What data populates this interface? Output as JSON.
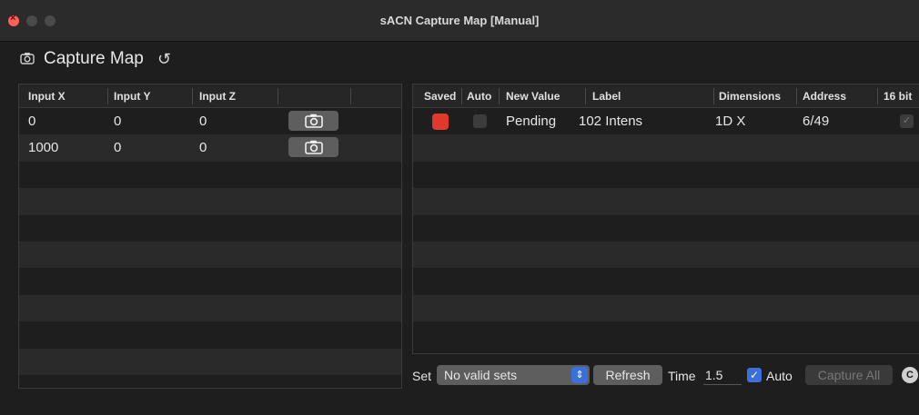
{
  "window": {
    "title": "sACN Capture Map [Manual]"
  },
  "toolbar": {
    "title": "Capture Map",
    "camera_icon": "camera-icon",
    "reset_icon": "reset-icon"
  },
  "inputs_table": {
    "columns": [
      "Input X",
      "Input Y",
      "Input Z"
    ],
    "rows": [
      {
        "x": "0",
        "y": "0",
        "z": "0"
      },
      {
        "x": "1000",
        "y": "0",
        "z": "0"
      }
    ]
  },
  "outputs_table": {
    "columns": [
      "Saved",
      "Auto",
      "New Value",
      "Label",
      "Dimensions",
      "Address",
      "16 bit"
    ],
    "rows": [
      {
        "saved": true,
        "auto": false,
        "new_value": "Pending",
        "label": "102 Intens",
        "dimensions": "1D X",
        "address": "6/49",
        "bit16": true
      }
    ]
  },
  "controls": {
    "set_label": "Set",
    "set_value": "No valid sets",
    "refresh_label": "Refresh",
    "time_label": "Time",
    "time_value": "1.5",
    "auto_label": "Auto",
    "auto_checked": true,
    "capture_all_label": "Capture All",
    "c_badge": "C"
  },
  "colors": {
    "saved": "#e2372b",
    "accent": "#3b6fd9"
  }
}
